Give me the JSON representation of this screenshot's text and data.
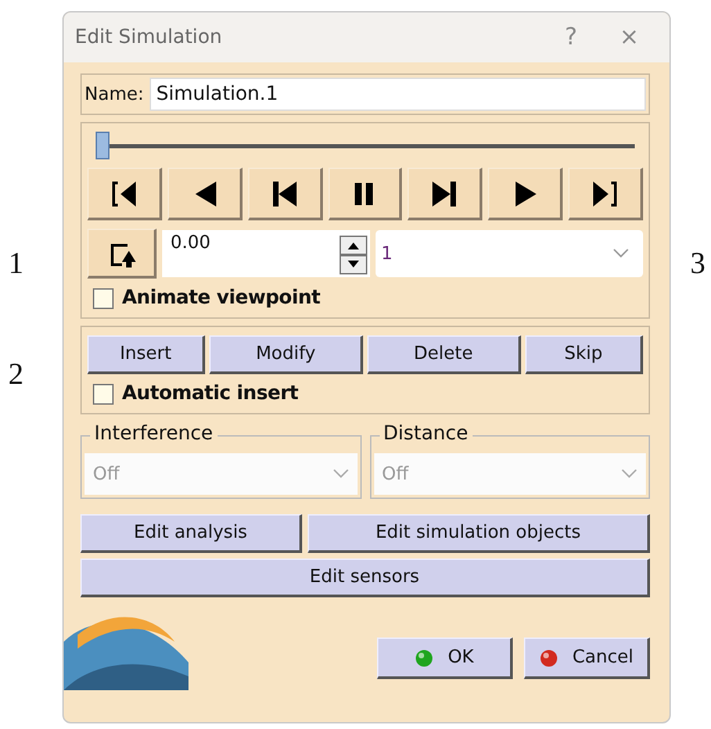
{
  "left_markers": [
    "1",
    "2"
  ],
  "right_markers": [
    "3"
  ],
  "window": {
    "title": "Edit Simulation",
    "help": "?",
    "close": "×"
  },
  "name_field": {
    "label": "Name:",
    "value": "Simulation.1"
  },
  "timeline": {
    "level": 0
  },
  "transport": [
    {
      "kind": "first"
    },
    {
      "kind": "back"
    },
    {
      "kind": "step_back"
    },
    {
      "kind": "pause"
    },
    {
      "kind": "step_forward"
    },
    {
      "kind": "play"
    },
    {
      "kind": "last"
    }
  ],
  "time_field": {
    "value": "0.00"
  },
  "step_dropdown": {
    "value": "1"
  },
  "animate_viewpoint": {
    "label": "Animate viewpoint",
    "checked": false
  },
  "action_buttons": [
    "Insert",
    "Modify",
    "Delete",
    "Skip"
  ],
  "automatic_insert": {
    "label": "Automatic insert",
    "checked": false
  },
  "combos": [
    {
      "legend": "Interference",
      "value": "Off",
      "disabled": true
    },
    {
      "legend": "Distance",
      "value": "Off",
      "disabled": true
    }
  ],
  "edit_buttons": [
    "Edit analysis",
    "Edit simulation objects",
    "Edit sensors"
  ],
  "footer_buttons": [
    {
      "label": "OK",
      "kind": "ok"
    },
    {
      "label": "Cancel",
      "kind": "cancel"
    }
  ]
}
